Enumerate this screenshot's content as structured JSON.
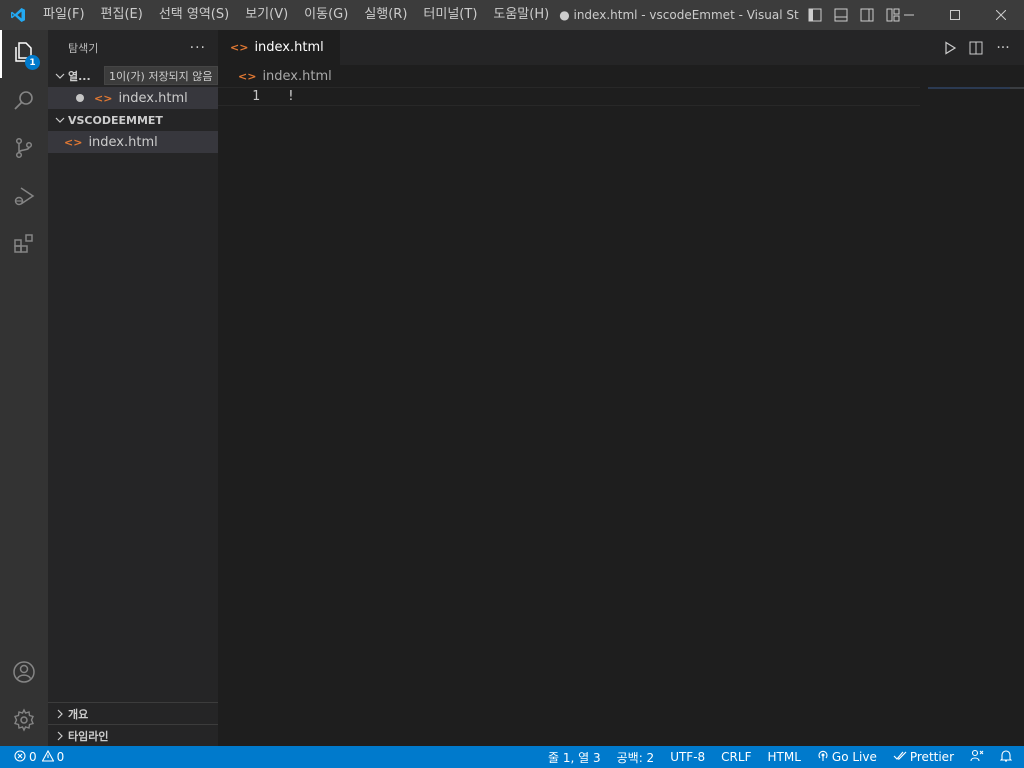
{
  "titlebar": {
    "menu": [
      "파일(F)",
      "편집(E)",
      "선택 영역(S)",
      "보기(V)",
      "이동(G)",
      "실행(R)",
      "터미널(T)",
      "도움말(H)"
    ],
    "title": "● index.html - vscodeEmmet - Visual Studio..."
  },
  "activity": {
    "explorer_badge": "1",
    "icons": [
      "files-icon",
      "search-icon",
      "source-control-icon",
      "run-debug-icon",
      "extensions-icon",
      "account-icon",
      "gear-icon"
    ]
  },
  "sidebar": {
    "title": "탐색기",
    "more": "···",
    "open_editors_label": "열...",
    "open_editors_tooltip": "1이(가) 저장되지 않음",
    "open_file": "index.html",
    "folder_label": "VSCODEEMMET",
    "folder_file": "index.html",
    "outline_label": "개요",
    "timeline_label": "타임라인"
  },
  "editor": {
    "tab_label": "index.html",
    "breadcrumb": "index.html",
    "lines": [
      {
        "num": "1",
        "text": "!"
      }
    ],
    "more": "···"
  },
  "status": {
    "errors": "0",
    "warnings": "0",
    "position": "줄 1, 열 3",
    "spaces": "공백: 2",
    "encoding": "UTF-8",
    "eol": "CRLF",
    "language": "HTML",
    "golive": "Go Live",
    "prettier": "Prettier"
  },
  "colors": {
    "statusbar": "#007acc",
    "titlebar": "#3c3c3c",
    "activitybar": "#333333",
    "sidebar": "#252526",
    "editor": "#1e1e1e",
    "html_icon": "#e37933"
  }
}
